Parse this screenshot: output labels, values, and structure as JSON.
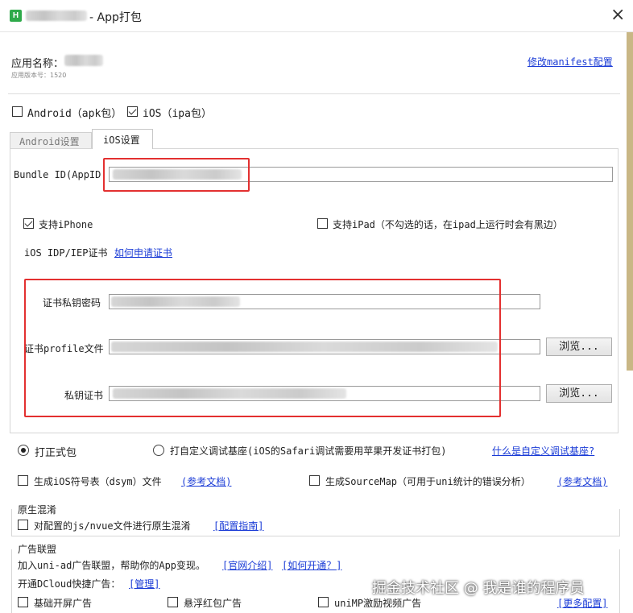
{
  "window": {
    "title": "- App打包",
    "close_glyph": "×"
  },
  "app": {
    "name_label": "应用名称：",
    "version_label": "应用版本号：1520",
    "manifest_link": "修改manifest配置"
  },
  "platforms": {
    "android_label": "Android（apk包）",
    "android_checked": false,
    "ios_label": "iOS（ipa包）",
    "ios_checked": true
  },
  "tabs": [
    {
      "label": "Android设置",
      "active": false
    },
    {
      "label": "iOS设置",
      "active": true
    }
  ],
  "ios": {
    "bundle_label": "Bundle ID(AppID",
    "support_iphone_label": "支持iPhone",
    "support_iphone_checked": true,
    "support_ipad_label": "支持iPad（不勾选的话，在ipad上运行时会有黑边）",
    "support_ipad_checked": false,
    "cert_label": "iOS IDP/IEP证书",
    "cert_link": "如何申请证书",
    "private_key_password_label": "证书私钥密码",
    "profile_label": "证书profile文件",
    "private_key_cert_label": "私钥证书",
    "browse_label": "浏览..."
  },
  "build": {
    "formal_label": "打正式包",
    "formal_selected": true,
    "custom_base_label": "打自定义调试基座(iOS的Safari调试需要用苹果开发证书打包)",
    "custom_base_selected": false,
    "custom_base_link": "什么是自定义调试基座?",
    "dsym_label": "生成iOS符号表（dsym）文件",
    "dsym_link": "(参考文档)",
    "sourcemap_label": "生成SourceMap（可用于uni统计的错误分析）",
    "sourcemap_link": "(参考文档)"
  },
  "obfuscation": {
    "group_title": "原生混淆",
    "checkbox_label": "对配置的js/nvue文件进行原生混淆",
    "link": "[配置指南]"
  },
  "ads": {
    "group_title": "广告联盟",
    "line1_text": "加入uni-ad广告联盟，帮助你的App变现。",
    "line1_link1": "[官网介绍]",
    "line1_link2": "[如何开通？]",
    "line2_text": "开通DCloud快捷广告：",
    "line2_link": "[管理]",
    "splash_label": "基础开屏广告",
    "redpack_label": "悬浮红包广告",
    "video_label": "uniMP激励视频广告",
    "more_link": "[更多配置]"
  },
  "watermark": "掘金技术社区 @ 我是谁的程序员",
  "colors": {
    "accent_link": "#1a3bd6",
    "annotation_red": "#e33030",
    "app_icon_green": "#2eaa4a"
  }
}
